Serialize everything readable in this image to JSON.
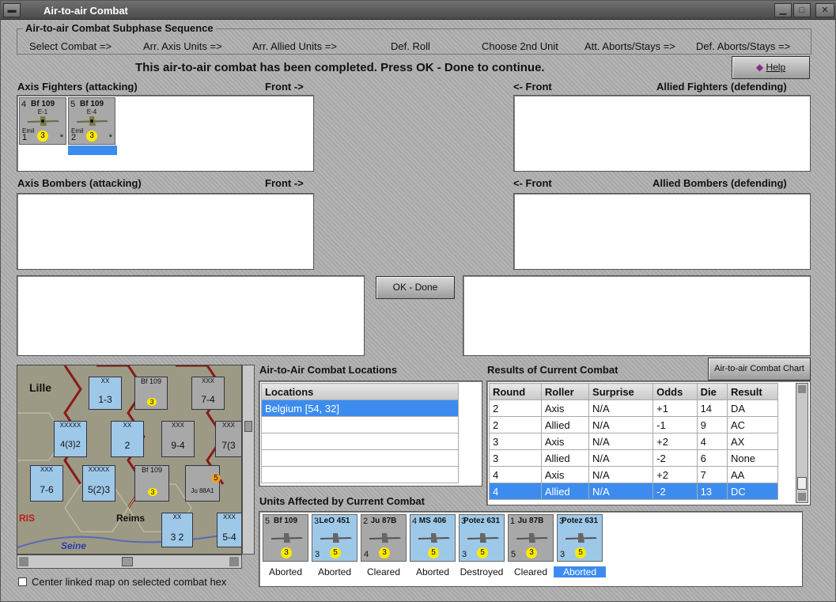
{
  "window": {
    "title": "Air-to-air Combat"
  },
  "sequence": {
    "title": "Air-to-air Combat Subphase Sequence",
    "steps": [
      "Select Combat =>",
      "Arr. Axis Units =>",
      "Arr. Allied Units =>",
      "Def. Roll",
      "Choose 2nd Unit",
      "Att. Aborts/Stays =>",
      "Def. Aborts/Stays =>"
    ]
  },
  "status_message": "This air-to-air combat has been completed.  Press OK - Done to continue.",
  "help_label": "Help",
  "axis_fighters": {
    "label": "Axis Fighters (attacking)",
    "front": "Front ->",
    "units": [
      {
        "name": "Bf 109",
        "sub": "E-1",
        "tag": "Emil",
        "tl": "4",
        "bl": "1",
        "yc": "3",
        "br": "*"
      },
      {
        "name": "Bf 109",
        "sub": "E-4",
        "tag": "Emil",
        "tl": "5",
        "bl": "2",
        "yc": "3",
        "br": "*"
      }
    ]
  },
  "allied_fighters": {
    "label": "Allied Fighters (defending)",
    "front": "<- Front"
  },
  "axis_bombers": {
    "label": "Axis Bombers (attacking)",
    "front": "Front ->"
  },
  "allied_bombers": {
    "label": "Allied Bombers (defending)",
    "front": "<- Front"
  },
  "ok_done": "OK - Done",
  "map": {
    "city_lille": "Lille",
    "city_reims": "Reims",
    "river": "Seine",
    "city_paris": "RIS",
    "hexes": [
      {
        "top": "XX",
        "bottom": "1-3"
      },
      {
        "top": "Bf 109",
        "bottom": "3"
      },
      {
        "top": "XXX",
        "bottom": "7-4"
      },
      {
        "top": "XXXXX",
        "bottom": "4(3)2"
      },
      {
        "top": "XX",
        "bottom": "2"
      },
      {
        "top": "XXX",
        "bottom": "9-4"
      },
      {
        "top": "XXX",
        "bottom": "7(3"
      },
      {
        "top": "XXX",
        "bottom": "7-6"
      },
      {
        "top": "XXXXX",
        "bottom": "5(2)3"
      },
      {
        "top": "Bf 109",
        "bottom": "3"
      },
      {
        "top": "Ju 88A1",
        "bottom": "5"
      },
      {
        "top": "XX",
        "bottom": "3 2"
      },
      {
        "top": "XXX",
        "bottom": "5-4"
      }
    ]
  },
  "center_checkbox": "Center linked map on selected combat hex",
  "locations": {
    "title": "Air-to-Air Combat Locations",
    "header": "Locations",
    "rows": [
      "Belgium [54, 32]"
    ]
  },
  "results": {
    "title": "Results of Current Combat",
    "chart_button": "Air-to-air Combat Chart",
    "headers": [
      "Round",
      "Roller",
      "Surprise",
      "Odds",
      "Die",
      "Result"
    ],
    "rows": [
      [
        "2",
        "Axis",
        "N/A",
        "+1",
        "14",
        "DA"
      ],
      [
        "2",
        "Allied",
        "N/A",
        "-1",
        "9",
        "AC"
      ],
      [
        "3",
        "Axis",
        "N/A",
        "+2",
        "4",
        "AX"
      ],
      [
        "3",
        "Allied",
        "N/A",
        "-2",
        "6",
        "None"
      ],
      [
        "4",
        "Axis",
        "N/A",
        "+2",
        "7",
        "AA"
      ],
      [
        "4",
        "Allied",
        "N/A",
        "-2",
        "13",
        "DC"
      ]
    ]
  },
  "affected": {
    "title": "Units Affected by Current Combat",
    "units": [
      {
        "name": "Bf 109",
        "tl": "5",
        "bl": "",
        "yc": "3",
        "status": "Aborted",
        "color": "gray"
      },
      {
        "name": "LeO 451",
        "tl": "3",
        "bl": "3",
        "yc": "5",
        "status": "Aborted",
        "color": "blue"
      },
      {
        "name": "Ju 87B",
        "tl": "2",
        "bl": "4",
        "yc": "3",
        "status": "Cleared",
        "color": "gray"
      },
      {
        "name": "MS 406",
        "tl": "4",
        "bl": "",
        "yc": "5",
        "status": "Aborted",
        "color": "blue"
      },
      {
        "name": "Potez 631",
        "tl": "3",
        "bl": "3",
        "yc": "5",
        "status": "Destroyed",
        "color": "blue"
      },
      {
        "name": "Ju 87B",
        "tl": "1",
        "bl": "5",
        "yc": "3",
        "status": "Cleared",
        "color": "gray"
      },
      {
        "name": "Potez 631",
        "tl": "3",
        "bl": "3",
        "yc": "5",
        "status": "Aborted",
        "color": "blue"
      }
    ]
  }
}
